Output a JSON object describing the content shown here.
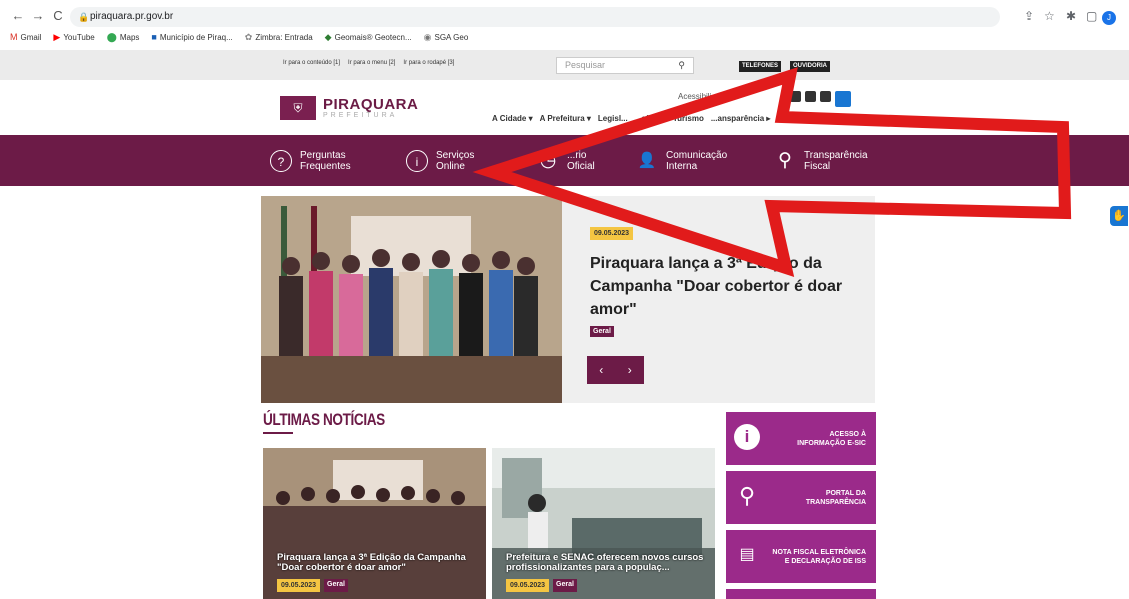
{
  "browser": {
    "url": "piraquara.pr.gov.br",
    "avatar_letter": "J",
    "bookmarks": [
      {
        "icon": "M",
        "label": "Gmail"
      },
      {
        "icon": "▶",
        "label": "YouTube"
      },
      {
        "icon": "⬤",
        "label": "Maps"
      },
      {
        "icon": "■",
        "label": "Município de Piraq..."
      },
      {
        "icon": "✿",
        "label": "Zimbra: Entrada"
      },
      {
        "icon": "◆",
        "label": "Geomais® Geotecn..."
      },
      {
        "icon": "◉",
        "label": "SGA Geo"
      }
    ]
  },
  "utility": {
    "skip_content": "Ir para o conteúdo [1]",
    "skip_menu": "Ir para o menu [2]",
    "skip_footer": "Ir para o rodapé [3]",
    "search_placeholder": "Pesquisar",
    "telefones": "TELEFONES",
    "ouvidoria": "OUVIDORIA"
  },
  "header": {
    "logo_name": "PIRAQUARA",
    "logo_sub": "PREFEITURA",
    "accessibility": "Acessibili...",
    "nav": [
      "A Cidade ▾",
      "A Prefeitura ▾",
      "Legisl...",
      "...ções ▾",
      "Turismo",
      "...ansparência ▸"
    ]
  },
  "quicklinks": [
    {
      "icon": "?",
      "line1": "Perguntas",
      "line2": "Frequentes"
    },
    {
      "icon": "i",
      "line1": "Serviços",
      "line2": "Online"
    },
    {
      "icon": "◷",
      "line1": "...rio",
      "line2": "Oficial"
    },
    {
      "icon": "👤",
      "line1": "Comunicação",
      "line2": "Interna"
    },
    {
      "icon": "⚲",
      "line1": "Transparência",
      "line2": "Fiscal"
    }
  ],
  "hero": {
    "date": "09.05.2023",
    "title": "Piraquara lança a 3ª Edição da Campanha \"Doar cobertor é doar amor\"",
    "category": "Geral",
    "prev": "‹",
    "next": "›"
  },
  "news": {
    "section_title": "ÚLTIMAS NOTÍCIAS",
    "items": [
      {
        "title": "Piraquara lança a 3ª Edição da Campanha \"Doar cobertor é doar amor\"",
        "date": "09.05.2023",
        "category": "Geral"
      },
      {
        "title": "Prefeitura e SENAC oferecem novos cursos profissionalizantes para a populaç...",
        "date": "09.05.2023",
        "category": "Geral"
      }
    ]
  },
  "sidebar": [
    {
      "line1": "ACESSO À",
      "line2": "INFORMAÇÃO E-SIC"
    },
    {
      "line1": "PORTAL DA",
      "line2": "TRANSPARÊNCIA"
    },
    {
      "line1": "NOTA FISCAL ELETRÔNICA",
      "line2": "E DECLARAÇÃO DE ISS"
    }
  ],
  "colors": {
    "brand": "#6c1b47",
    "sidebar": "#9b2a8a",
    "badge": "#f4c542",
    "annotation": "#e11b1b"
  }
}
